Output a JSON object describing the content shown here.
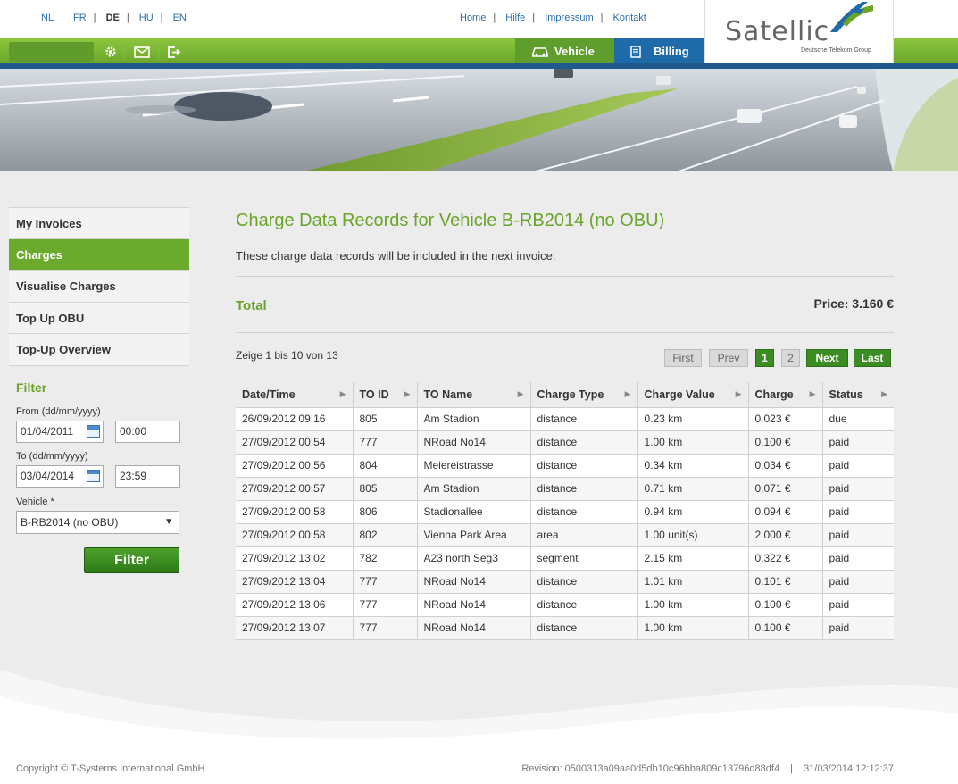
{
  "languages": [
    {
      "code": "NL",
      "current": false
    },
    {
      "code": "FR",
      "current": false
    },
    {
      "code": "DE",
      "current": true
    },
    {
      "code": "HU",
      "current": false
    },
    {
      "code": "EN",
      "current": false
    }
  ],
  "top_links": [
    "Home",
    "Hilfe",
    "Impressum",
    "Kontakt"
  ],
  "tabs": {
    "vehicle": "Vehicle",
    "billing": "Billing"
  },
  "logo": {
    "text": "Satellic",
    "subtitle": "Deutsche Telekom Group"
  },
  "sidebar": {
    "items": [
      {
        "label": "My Invoices",
        "active": false
      },
      {
        "label": "Charges",
        "active": true
      },
      {
        "label": "Visualise Charges",
        "active": false
      },
      {
        "label": "Top Up OBU",
        "active": false
      },
      {
        "label": "Top-Up Overview",
        "active": false
      }
    ],
    "filter": {
      "title": "Filter",
      "from_label": "From (dd/mm/yyyy)",
      "from_date": "01/04/2011",
      "from_time": "00:00",
      "to_label": "To (dd/mm/yyyy)",
      "to_date": "03/04/2014",
      "to_time": "23:59",
      "vehicle_label": "Vehicle *",
      "vehicle_value": "B-RB2014 (no OBU)",
      "button": "Filter"
    }
  },
  "main": {
    "title": "Charge Data Records for Vehicle B-RB2014 (no OBU)",
    "description": "These charge data records will be included in the next invoice.",
    "total_label": "Total",
    "total_price": "Price: 3.160 €",
    "paging_info": "Zeige 1 bis 10 von 13",
    "pager": {
      "first": "First",
      "prev": "Prev",
      "page1": "1",
      "page2": "2",
      "next": "Next",
      "last": "Last"
    },
    "columns": [
      "Date/Time",
      "TO ID",
      "TO Name",
      "Charge Type",
      "Charge Value",
      "Charge",
      "Status"
    ],
    "rows": [
      [
        "26/09/2012 09:16",
        "805",
        "Am Stadion",
        "distance",
        "0.23 km",
        "0.023 €",
        "due"
      ],
      [
        "27/09/2012 00:54",
        "777",
        "NRoad No14",
        "distance",
        "1.00 km",
        "0.100 €",
        "paid"
      ],
      [
        "27/09/2012 00:56",
        "804",
        "Meiereistrasse",
        "distance",
        "0.34 km",
        "0.034 €",
        "paid"
      ],
      [
        "27/09/2012 00:57",
        "805",
        "Am Stadion",
        "distance",
        "0.71 km",
        "0.071 €",
        "paid"
      ],
      [
        "27/09/2012 00:58",
        "806",
        "Stadionallee",
        "distance",
        "0.94 km",
        "0.094 €",
        "paid"
      ],
      [
        "27/09/2012 00:58",
        "802",
        "Vienna Park Area",
        "area",
        "1.00 unit(s)",
        "2.000 €",
        "paid"
      ],
      [
        "27/09/2012 13:02",
        "782",
        "A23 north Seg3",
        "segment",
        "2.15 km",
        "0.322 €",
        "paid"
      ],
      [
        "27/09/2012 13:04",
        "777",
        "NRoad No14",
        "distance",
        "1.01 km",
        "0.101 €",
        "paid"
      ],
      [
        "27/09/2012 13:06",
        "777",
        "NRoad No14",
        "distance",
        "1.00 km",
        "0.100 €",
        "paid"
      ],
      [
        "27/09/2012 13:07",
        "777",
        "NRoad No14",
        "distance",
        "1.00 km",
        "0.100 €",
        "paid"
      ]
    ]
  },
  "footer": {
    "copyright": "Copyright © T-Systems International GmbH",
    "revision": "Revision: 0500313a09aa0d5db10c96bba809c13796d88df4",
    "timestamp": "31/03/2014 12:12:37"
  },
  "colors": {
    "brand_green": "#6aa52a",
    "brand_blue": "#1f6aa8",
    "button_green": "#3b8c22"
  },
  "icons": [
    "settings-icon",
    "mail-icon",
    "logout-icon",
    "car-icon",
    "document-icon",
    "calendar-icon"
  ]
}
